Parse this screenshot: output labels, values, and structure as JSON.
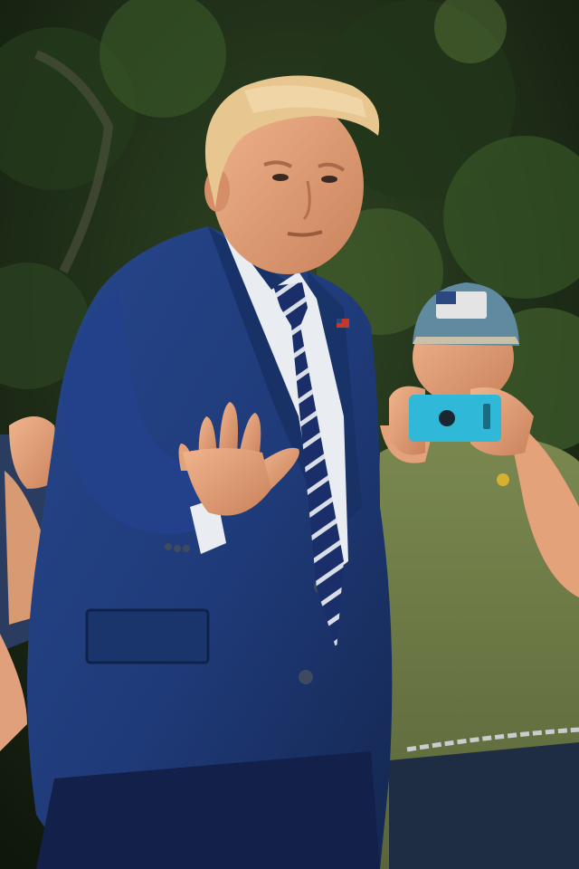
{
  "photo": {
    "palette": {
      "foliage_dark": "#16200f",
      "foliage_mid": "#2f4522",
      "foliage_light": "#5c7a3a",
      "suit_navy": "#1f3a78",
      "suit_shadow": "#142750",
      "shirt_white": "#e9edf2",
      "tie_navy": "#1a2f6a",
      "tie_stripe": "#d8dde6",
      "skin": "#e3a27a",
      "hair": "#e8c690",
      "olive_shirt": "#6d7a45",
      "cap_blue": "#5f8aa0",
      "phone_cyan": "#2fb8d8",
      "jeans": "#1e2c44"
    },
    "subjects": [
      "man-in-navy-suit-waving",
      "man-in-olive-shirt-filming-with-phone",
      "raised-hand-left-edge"
    ]
  }
}
